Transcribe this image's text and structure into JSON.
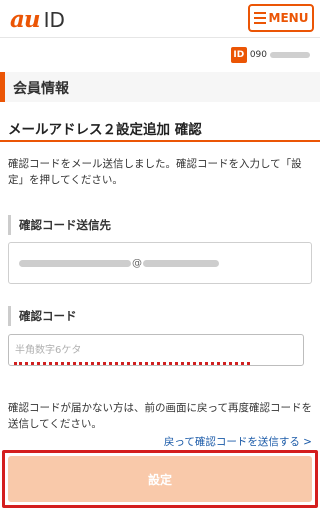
{
  "header": {
    "logo_au": "au",
    "logo_id": "ID",
    "menu_label": "MENU"
  },
  "account": {
    "id_badge": "ID",
    "number_prefix": "090"
  },
  "section": {
    "title": "会員情報"
  },
  "page": {
    "title": "メールアドレス２設定追加 確認",
    "description": "確認コードをメール送信しました。確認コードを入力して「設定」を押してください。"
  },
  "destination": {
    "label": "確認コード送信先",
    "at_sign": "@"
  },
  "code": {
    "label": "確認コード",
    "placeholder": "半角数字6ケタ",
    "value": ""
  },
  "help": {
    "text": "確認コードが届かない方は、前の画面に戻って再度確認コードを送信してください。",
    "resend_link": "戻って確認コードを送信する >"
  },
  "actions": {
    "submit_label": "設定"
  },
  "colors": {
    "brand": "#eb5505",
    "link": "#1a5aa8",
    "submit_disabled": "#f9c9aa",
    "highlight_frame": "#d41e1e"
  },
  "icons": {
    "menu": "hamburger-menu-icon",
    "account": "id-badge-icon"
  }
}
